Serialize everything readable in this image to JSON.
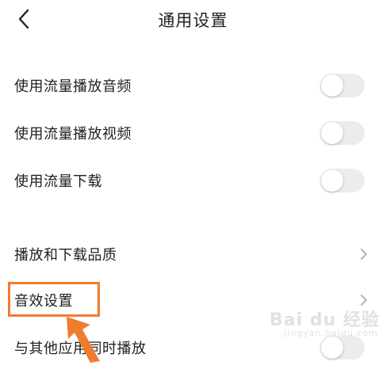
{
  "header": {
    "title": "通用设置"
  },
  "settings": {
    "toggles": [
      {
        "label": "使用流量播放音频",
        "enabled": false
      },
      {
        "label": "使用流量播放视频",
        "enabled": false
      },
      {
        "label": "使用流量下载",
        "enabled": false
      }
    ],
    "links": [
      {
        "label": "播放和下载品质"
      },
      {
        "label": "音效设置"
      }
    ],
    "partial_row": {
      "label": "与其他应用同时播放",
      "enabled": false
    }
  },
  "watermark": {
    "brand": "Bai du 经验",
    "sub": "jingyan.baidu.com"
  },
  "colors": {
    "highlight": "#f07c2e",
    "toggle_off": "#ececec",
    "chevron": "#b5b5b5"
  }
}
